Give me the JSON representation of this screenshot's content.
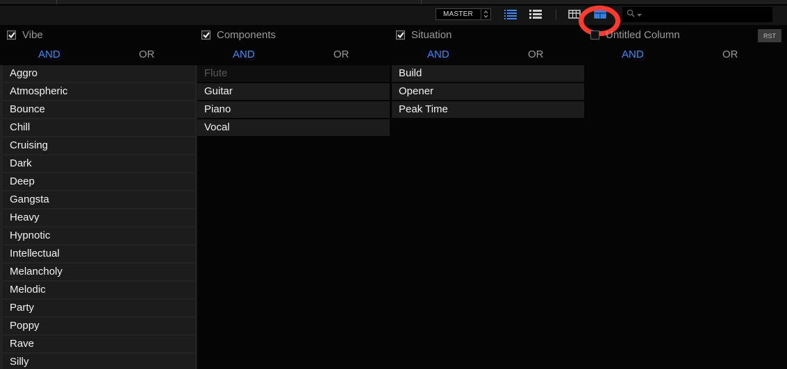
{
  "toolbar": {
    "master_label": "MASTER",
    "search_placeholder": ""
  },
  "columns": [
    {
      "title": "Vibe",
      "checked": true,
      "and_label": "AND",
      "or_label": "OR",
      "items": [
        "Aggro",
        "Atmospheric",
        "Bounce",
        "Chill",
        "Cruising",
        "Dark",
        "Deep",
        "Gangsta",
        "Heavy",
        "Hypnotic",
        "Intellectual",
        "Melancholy",
        "Melodic",
        "Party",
        "Poppy",
        "Rave",
        "Silly"
      ]
    },
    {
      "title": "Components",
      "checked": true,
      "and_label": "AND",
      "or_label": "OR",
      "items": [
        "Flute",
        "Guitar",
        "Piano",
        "Vocal"
      ]
    },
    {
      "title": "Situation",
      "checked": true,
      "and_label": "AND",
      "or_label": "OR",
      "items": [
        "Build",
        "Opener",
        "Peak Time"
      ]
    },
    {
      "title": "Untitled Column",
      "checked": false,
      "and_label": "AND",
      "or_label": "OR",
      "items": []
    }
  ],
  "rst_label": "RST",
  "colors": {
    "accent": "#3a8dff",
    "annotation": "#ff3b2f"
  },
  "icons": {
    "toolbar": [
      "list-view-icon",
      "detail-list-icon",
      "grid-view-icon",
      "column-browser-icon",
      "search-icon",
      "chevron-down-icon"
    ]
  }
}
